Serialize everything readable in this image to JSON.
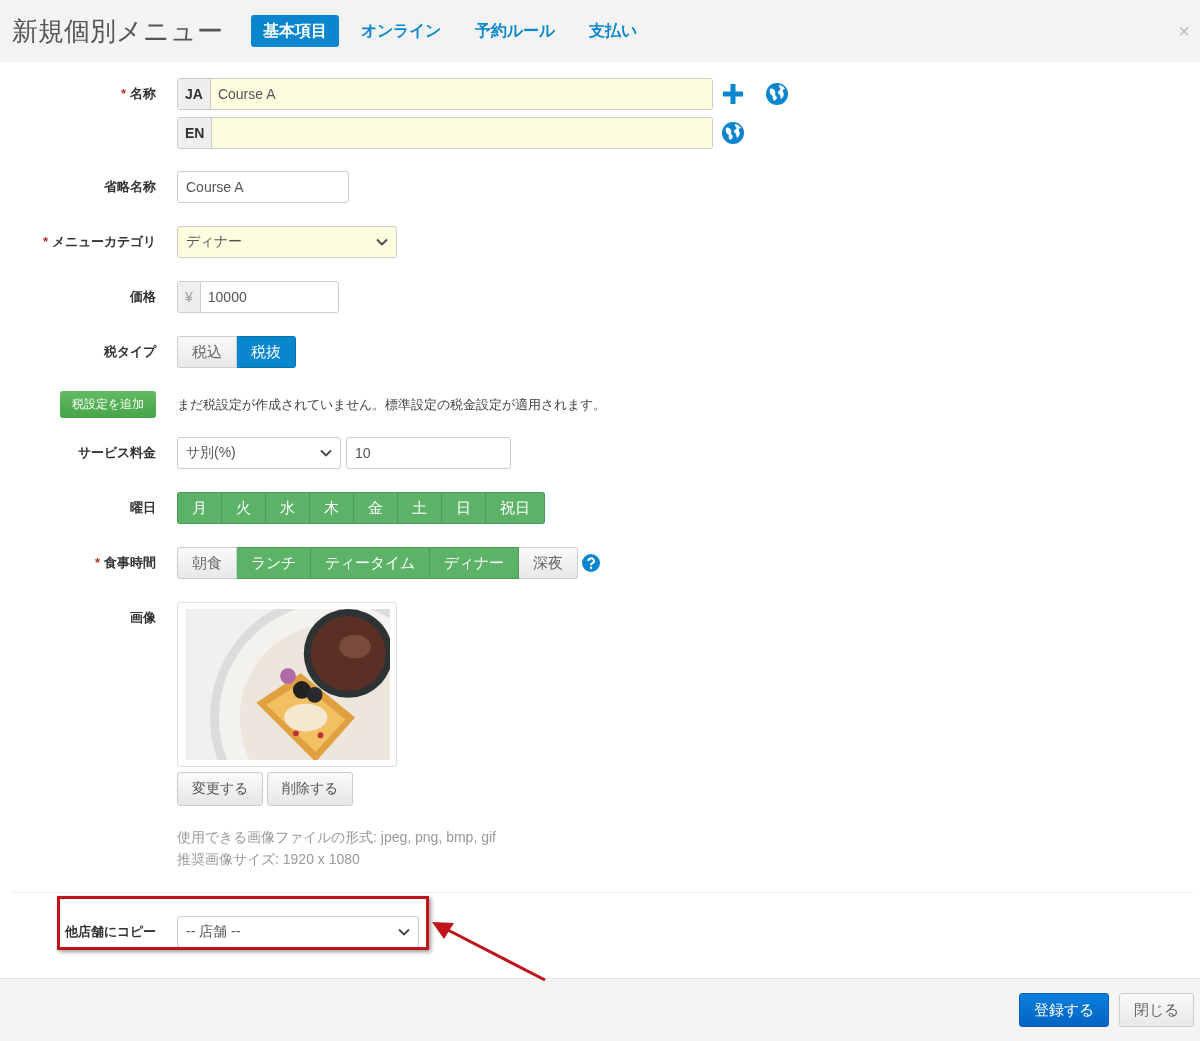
{
  "header": {
    "title": "新規個別メニュー",
    "close": "×",
    "tabs": [
      {
        "label": "基本項目",
        "selected": true
      },
      {
        "label": "オンライン",
        "selected": false
      },
      {
        "label": "予約ルール",
        "selected": false
      },
      {
        "label": "支払い",
        "selected": false
      }
    ]
  },
  "rows": [
    {
      "kind": "names",
      "mark": "*",
      "label": "名称",
      "highlighted": true,
      "entries": [
        {
          "lang": "JA",
          "value": "Course A",
          "add": true
        },
        {
          "lang": "EN"
        }
      ]
    },
    {
      "kind": "text",
      "label": "省略名称",
      "value": "Course A"
    },
    {
      "kind": "select",
      "mark": "*",
      "label": "メニューカテゴリ",
      "highlighted": true,
      "value": "ディナー"
    },
    {
      "kind": "price",
      "label": "価格",
      "prefix": "¥",
      "value": "10000"
    },
    {
      "kind": "toggle",
      "label": "税タイプ",
      "color": "#0a86cf",
      "options": [
        {
          "label": "税込",
          "selected": false
        },
        {
          "label": "税抜",
          "selected": true
        }
      ]
    },
    {
      "kind": "note",
      "button": "税設定を追加",
      "text": "まだ税設定が作成されていません。標準設定の税金設定が適用されます。"
    },
    {
      "kind": "select_input",
      "label": "サービス料金",
      "select": "サ別(%)",
      "value": "10"
    },
    {
      "kind": "toggle",
      "label": "曜日",
      "color": "#5cb367",
      "options": [
        {
          "label": "月",
          "selected": true
        },
        {
          "label": "火",
          "selected": true
        },
        {
          "label": "水",
          "selected": true
        },
        {
          "label": "木",
          "selected": true
        },
        {
          "label": "金",
          "selected": true
        },
        {
          "label": "土",
          "selected": true
        },
        {
          "label": "日",
          "selected": true
        },
        {
          "label": "祝日",
          "selected": true
        }
      ]
    },
    {
      "kind": "toggle",
      "mark": "*",
      "label": "食事時間",
      "color": "#5cb367",
      "help": true,
      "options": [
        {
          "label": "朝食",
          "selected": false
        },
        {
          "label": "ランチ",
          "selected": true
        },
        {
          "label": "ティータイム",
          "selected": true
        },
        {
          "label": "ディナー",
          "selected": true
        },
        {
          "label": "深夜",
          "selected": false
        }
      ]
    },
    {
      "label": "画像",
      "buttons": [
        "変更する",
        "削除する"
      ],
      "notes": [
        "使用できる画像ファイルの形式: jpeg, png, bmp, gif",
        "推奨画像サイズ: 1920 x 1080"
      ]
    }
  ],
  "copy": {
    "label": "他店舗にコピー",
    "value": "-- 店舗 --"
  },
  "footer": {
    "buttons": [
      {
        "label": "登録する",
        "primary": true
      },
      {
        "label": "閉じる",
        "primary": false
      }
    ]
  }
}
